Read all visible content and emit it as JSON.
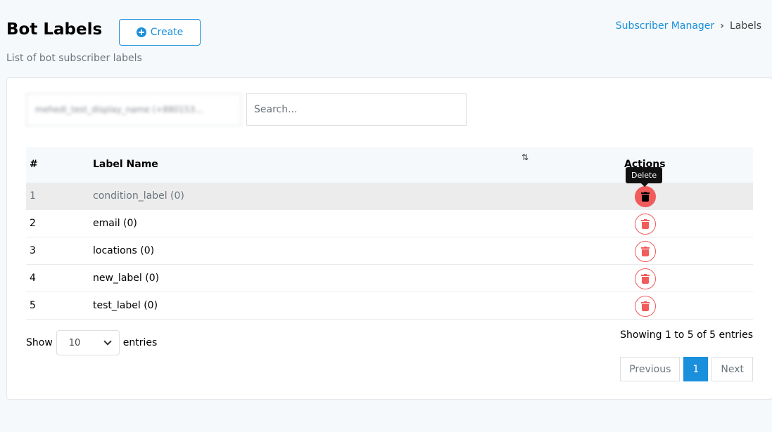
{
  "header": {
    "title": "Bot Labels",
    "create_label": "Create",
    "subtitle": "List of bot subscriber labels"
  },
  "breadcrumb": {
    "parent": "Subscriber Manager",
    "current": "Labels"
  },
  "filters": {
    "bot_select_value": "mehedi_test_display_name (+880153...",
    "search_placeholder": "Search..."
  },
  "table": {
    "headers": {
      "num": "#",
      "name": "Label Name",
      "actions": "Actions"
    },
    "tooltip": "Delete",
    "rows": [
      {
        "num": "1",
        "name": "condition_label (0)"
      },
      {
        "num": "2",
        "name": "email (0)"
      },
      {
        "num": "3",
        "name": "locations (0)"
      },
      {
        "num": "4",
        "name": "new_label (0)"
      },
      {
        "num": "5",
        "name": "test_label (0)"
      }
    ]
  },
  "footer": {
    "show_label": "Show",
    "entries_label": "entries",
    "page_length": "10",
    "info": "Showing 1 to 5 of 5 entries",
    "previous": "Previous",
    "current_page": "1",
    "next": "Next"
  },
  "colors": {
    "accent": "#1a8fdb",
    "danger": "#f15b5b"
  }
}
